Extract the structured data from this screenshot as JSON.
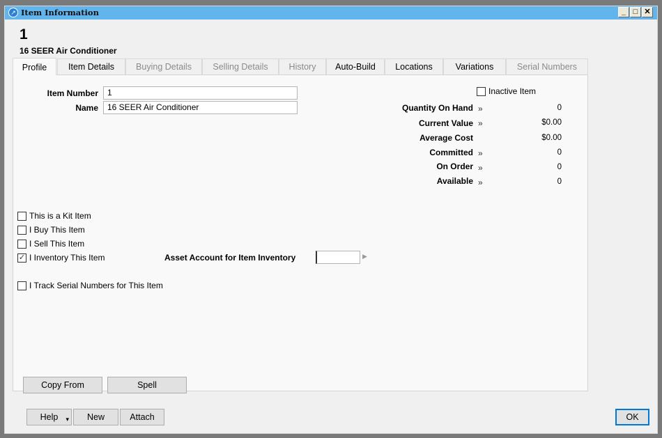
{
  "window": {
    "title": "Item Information",
    "controls": [
      "_",
      "□",
      "✕"
    ]
  },
  "header": {
    "item_number": "1",
    "item_name": "16 SEER Air Conditioner"
  },
  "tabs": [
    {
      "label": "Profile",
      "state": "active"
    },
    {
      "label": "Item Details",
      "state": "enabled"
    },
    {
      "label": "Buying Details",
      "state": "disabled"
    },
    {
      "label": "Selling Details",
      "state": "disabled"
    },
    {
      "label": "History",
      "state": "disabled"
    },
    {
      "label": "Auto-Build",
      "state": "enabled"
    },
    {
      "label": "Locations",
      "state": "enabled"
    },
    {
      "label": "Variations",
      "state": "enabled"
    },
    {
      "label": "Serial Numbers",
      "state": "disabled"
    }
  ],
  "profile": {
    "item_number_label": "Item Number",
    "item_number_value": "1",
    "name_label": "Name",
    "name_value": "16 SEER Air Conditioner",
    "inactive_label": "Inactive Item",
    "inactive_checked": false,
    "stats": [
      {
        "label": "Quantity On Hand",
        "drill": "»",
        "value": "0"
      },
      {
        "label": "Current Value",
        "drill": "»",
        "value": "$0.00"
      },
      {
        "label": "Average Cost",
        "drill": "",
        "value": "$0.00"
      },
      {
        "label": "Committed",
        "drill": "»",
        "value": "0"
      },
      {
        "label": "On Order",
        "drill": "»",
        "value": "0"
      },
      {
        "label": "Available",
        "drill": "»",
        "value": "0"
      }
    ],
    "checkboxes": [
      {
        "label": "This is a Kit Item",
        "checked": false,
        "mark": ""
      },
      {
        "label": "I Buy This Item",
        "checked": false,
        "mark": ""
      },
      {
        "label": "I Sell This Item",
        "checked": false,
        "mark": ""
      },
      {
        "label": "I Inventory This Item",
        "checked": true,
        "mark": "✓"
      },
      {
        "label": "I Track Serial Numbers for This Item",
        "checked": false,
        "mark": ""
      }
    ],
    "asset_account_label": "Asset Account for Item Inventory",
    "asset_account_value": "",
    "asset_arrow": "▶",
    "copy_from_label": "Copy From",
    "spell_label": "Spell"
  },
  "footer": {
    "help_label": "Help",
    "help_arrow": "▾",
    "new_label": "New",
    "attach_label": "Attach",
    "ok_label": "OK"
  }
}
